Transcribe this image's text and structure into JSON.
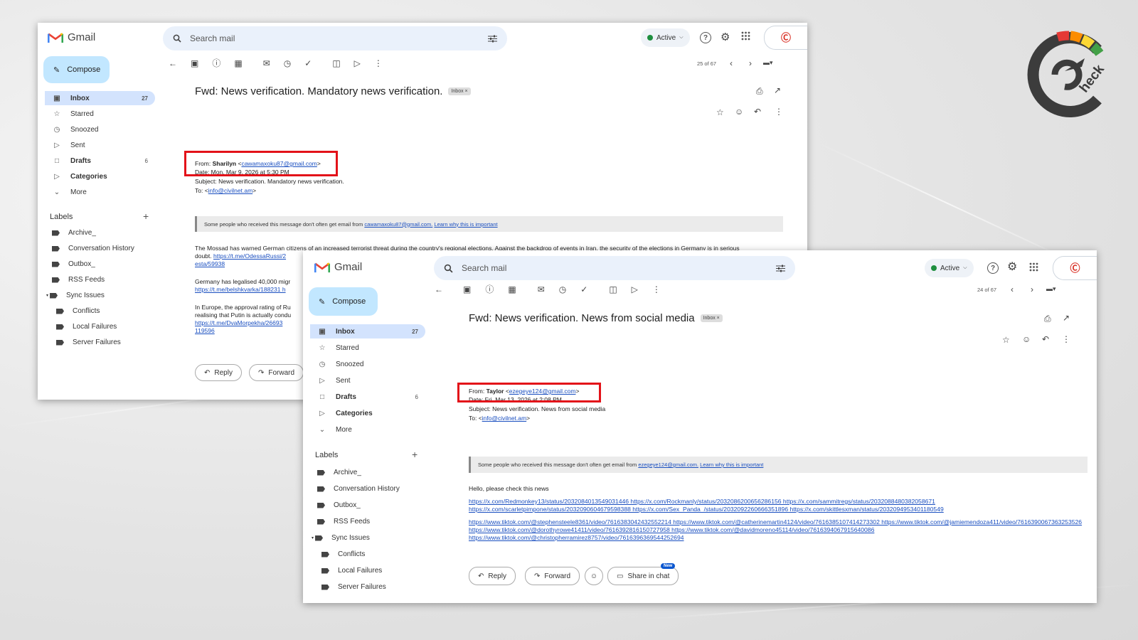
{
  "window1": {
    "app_name": "Gmail",
    "search_placeholder": "Search mail",
    "status": "Active",
    "compose_label": "Compose",
    "nav": [
      {
        "label": "Inbox",
        "count": "27"
      },
      {
        "label": "Starred",
        "count": ""
      },
      {
        "label": "Snoozed",
        "count": ""
      },
      {
        "label": "Sent",
        "count": ""
      },
      {
        "label": "Drafts",
        "count": "6"
      },
      {
        "label": "Categories",
        "count": ""
      },
      {
        "label": "More",
        "count": ""
      }
    ],
    "labels_title": "Labels",
    "labels": [
      "Archive_",
      "Conversation History",
      "Outbox_",
      "RSS Feeds",
      "Sync Issues",
      "Conflicts",
      "Local Failures",
      "Server Failures"
    ],
    "pager": "25 of 67",
    "subject": "Fwd: News verification. Mandatory news verification.",
    "inbox_chip": "Inbox ×",
    "from_prefix": "From:",
    "from_name": "Sharilyn",
    "from_email": "cawamaxoku87@gmail.com",
    "date_line": "Date: Mon, Mar 9, 2026 at 5:30 PM",
    "subject_line": "Subject: News verification. Mandatory news verification.",
    "to_prefix": "To: <",
    "to_email": "info@civilnet.am",
    "to_suffix": ">",
    "warn_text": "Some people who received this message don't often get email from",
    "warn_email": "cawamaxoku87@gmail.com.",
    "warn_link": "Learn why this is important",
    "body_1a": "The Mossad has warned German ci",
    "body_1_hidden": "tizens of an increased terrorist threat during the country's regional elections. Against the backdrop of events in Iran, the security of the elections in Germany is in serious",
    "body_1b": "doubt.",
    "body_1_link1": "https://t.me/OdessaRussi/2",
    "body_1_link2": "esta/59938",
    "body_2a": "Germany has legalised 40,000 migr",
    "body_2_link": "https://t.me/belshkvarka/188231 h",
    "body_3a": "In Europe, the approval rating of Ru",
    "body_3b": "realising that Putin is actually condu",
    "body_3_link1": "https://t.me/DvaMorpekha/26693",
    "body_3_link2": "119596",
    "reply_label": "Reply",
    "forward_label": "Forward"
  },
  "window2": {
    "app_name": "Gmail",
    "search_placeholder": "Search mail",
    "status": "Active",
    "compose_label": "Compose",
    "nav": [
      {
        "label": "Inbox",
        "count": "27"
      },
      {
        "label": "Starred",
        "count": ""
      },
      {
        "label": "Snoozed",
        "count": ""
      },
      {
        "label": "Sent",
        "count": ""
      },
      {
        "label": "Drafts",
        "count": "6"
      },
      {
        "label": "Categories",
        "count": ""
      },
      {
        "label": "More",
        "count": ""
      }
    ],
    "labels_title": "Labels",
    "labels": [
      "Archive_",
      "Conversation History",
      "Outbox_",
      "RSS Feeds",
      "Sync Issues",
      "Conflicts",
      "Local Failures",
      "Server Failures"
    ],
    "pager": "24 of 67",
    "subject": "Fwd: News verification. News from social media",
    "inbox_chip": "Inbox ×",
    "from_prefix": "From:",
    "from_name": "Taylor",
    "from_email": "ezegeye124@gmail.com",
    "date_line": "Date: Fri, Mar 13, 2026 at 2:08 PM",
    "subject_line": "Subject: News verification. News from social media",
    "to_prefix": "To: <",
    "to_email": "info@civilnet.am",
    "to_suffix": ">",
    "warn_text": "Some people who received this message don't often get email from",
    "warn_email": "ezegeye124@gmail.com.",
    "warn_link": "Learn why this is important",
    "greeting": "Hello, please check this news",
    "links_para1": "https://x.com/Redmonkey13/status/2032084013549031446 https://x.com/Rockmanly/status/2032086200656286156 https://x.com/sammitregs/status/2032088480382058671 https://x.com/scarletpimpone/status/2032090604679598388 https://x.com/Sex_Panda_/status/2032092260666351896 https://x.com/skittlesxman/status/2032094953401180549",
    "links_para2": "https://www.tiktok.com/@stephensteele8361/video/7616383042432552214 https://www.tiktok.com/@catherinemartin4124/video/7616385107414273302 https://www.tiktok.com/@jamiemendoza411/video/7616390067363253526 https://www.tiktok.com/@dorothyrowe41411/video/7616392816150727958 https://www.tiktok.com/@davidmoreno45114/video/7616394067915640086 https://www.tiktok.com/@christopherramirez8757/video/7616396369544252694",
    "reply_label": "Reply",
    "forward_label": "Forward",
    "share_label": "Share in chat",
    "new_badge": "New"
  },
  "logo": {
    "letters": "heck",
    "colors": [
      "#e53935",
      "#fb8c00",
      "#fdd835",
      "#43a047",
      "#3c3c3c"
    ]
  }
}
